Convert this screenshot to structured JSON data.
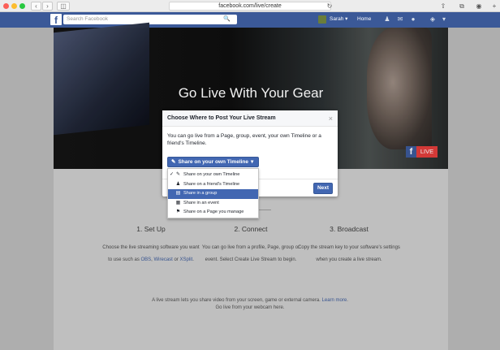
{
  "browser": {
    "url": "facebook.com/live/create",
    "back": "‹",
    "forward": "›",
    "sidebar_icon": "sidebar-icon",
    "reload": "↻"
  },
  "fb_header": {
    "logo": "f",
    "search_placeholder": "Search Facebook",
    "search_icon": "🔍",
    "user_name": "Sarah",
    "home": "Home"
  },
  "hero": {
    "title": "Go Live With Your Gear",
    "live_badge_f": "f",
    "live_badge_text": "LIVE"
  },
  "modal": {
    "title": "Choose Where to Post Your Live Stream",
    "close": "×",
    "description": "You can go live from a Page, group, event, your own Timeline or a friend's Timeline.",
    "selector_label": "Share on your own Timeline",
    "selector_caret": "▾",
    "next_label": "Next",
    "menu": [
      {
        "label": "Share on your own Timeline",
        "icon": "✎",
        "checked": true,
        "active": false
      },
      {
        "label": "Share on a friend's Timeline",
        "icon": "♟",
        "checked": false,
        "active": false
      },
      {
        "label": "Share in a group",
        "icon": "▤",
        "checked": false,
        "active": true
      },
      {
        "label": "Share in an event",
        "icon": "▦",
        "checked": false,
        "active": false
      },
      {
        "label": "Share on a Page you manage",
        "icon": "⚑",
        "checked": false,
        "active": false
      }
    ]
  },
  "steps": [
    {
      "title": "1. Set Up",
      "desc_a": "Choose the live streaming software you want to use such as ",
      "link1": "OBS",
      "desc_b": ", ",
      "link2": "Wirecast",
      "desc_c": " or ",
      "link3": "XSplit",
      "desc_d": "."
    },
    {
      "title": "2. Connect",
      "desc": "You can go live from a profile, Page, group or event. Select Create Live Stream to begin."
    },
    {
      "title": "3. Broadcast",
      "desc": "Copy the stream key to your software's settings when you create a live stream."
    }
  ],
  "footnote": {
    "text_a": "A live stream lets you share video from your screen, game or external camera. ",
    "link": "Learn more",
    "text_b": ".",
    "line2": "Go live from your webcam here."
  },
  "colors": {
    "fb_blue": "#3b5998",
    "button_blue": "#4267b2",
    "live_red": "#e13d3b"
  }
}
